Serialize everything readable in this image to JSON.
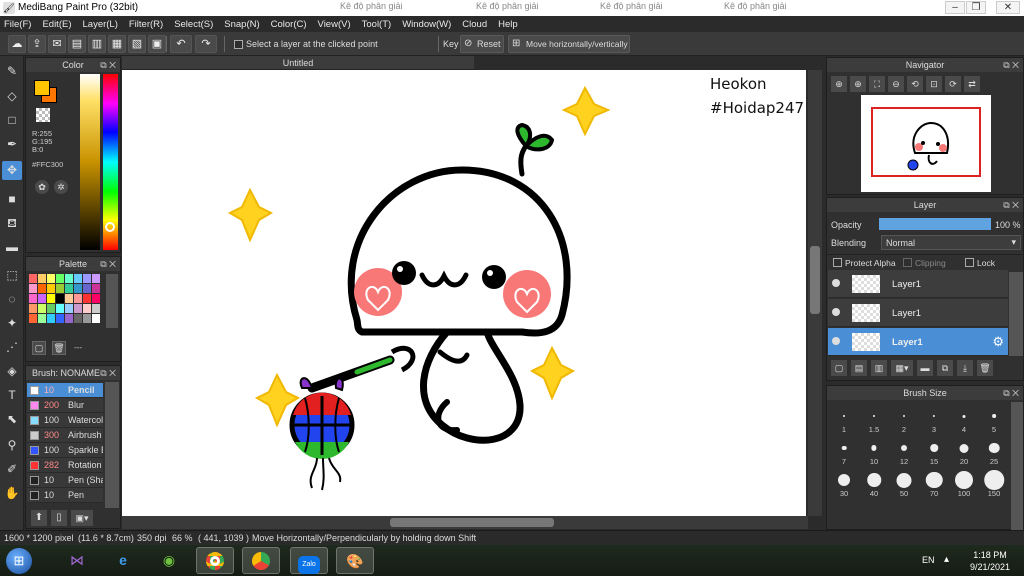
{
  "window": {
    "title": "MediBang Paint Pro (32bit)",
    "background_tabs": [
      "Kê độ phân giải",
      "Kê độ phân giải",
      "Kê độ phân giải",
      "Kê độ phân giải"
    ],
    "controls": [
      "–",
      "❐",
      "✕"
    ]
  },
  "menu": [
    "File(F)",
    "Edit(E)",
    "Layer(L)",
    "Filter(R)",
    "Select(S)",
    "Snap(N)",
    "Color(C)",
    "View(V)",
    "Tool(T)",
    "Window(W)",
    "Cloud",
    "Help"
  ],
  "toolbar": {
    "select_layer_label": "Select a layer at the clicked point",
    "key_label": "Key",
    "reset_label": "Reset",
    "move_label": "Move horizontally/vertically"
  },
  "color_panel": {
    "title": "Color",
    "primary": "#FFC300",
    "r": "R:255",
    "g": "G:195",
    "b": "B:0",
    "hex": "#FFC300"
  },
  "palette_panel": {
    "title": "Palette",
    "colors": [
      "#ff6666",
      "#ffcc66",
      "#ffff66",
      "#66ff66",
      "#66ffcc",
      "#66ccff",
      "#9999ff",
      "#cc99ff",
      "#ff99cc",
      "#ff6600",
      "#ffcc00",
      "#99cc33",
      "#33cc99",
      "#3399cc",
      "#6666cc",
      "#cc3399",
      "#ff66cc",
      "#cc66ff",
      "#ffff00",
      "#000000",
      "#ffcc99",
      "#ff9999",
      "#ff3333",
      "#ff0066",
      "#ff9966",
      "#ccff66",
      "#66cc66",
      "#66ffff",
      "#99ccff",
      "#cc99cc",
      "#ffcccc",
      "#cccccc",
      "#ff6633",
      "#99ff99",
      "#33ccff",
      "#3366ff",
      "#9966cc",
      "#666666",
      "#999999",
      "#ffffff"
    ],
    "dash": "---"
  },
  "brush_panel": {
    "title": "Brush: NONAME",
    "items": [
      {
        "size": "10",
        "name": "Pencil",
        "color": "#ffffff",
        "active": true
      },
      {
        "size": "200",
        "name": "Blur",
        "color": "#ff88ee",
        "active": false
      },
      {
        "size": "100",
        "name": "Watercolor",
        "color": "#88ddff",
        "active": false
      },
      {
        "size": "300",
        "name": "Airbrush",
        "color": "#cccccc",
        "active": false
      },
      {
        "size": "100",
        "name": "Sparkle Brush",
        "color": "#3355ff",
        "active": false
      },
      {
        "size": "282",
        "name": "Rotation",
        "color": "#ff3333",
        "active": false
      },
      {
        "size": "10",
        "name": "Pen (Sharp)",
        "color": "#222222",
        "active": false
      },
      {
        "size": "10",
        "name": "Pen",
        "color": "#222222",
        "active": false
      }
    ]
  },
  "canvas": {
    "tab": "Untitled",
    "watermark_line1": "Heokon",
    "watermark_line2": "#Hoidap247"
  },
  "navigator": {
    "title": "Navigator"
  },
  "layer_panel": {
    "title": "Layer",
    "opacity_label": "Opacity",
    "opacity_value": "100 %",
    "opacity_fraction": 1.0,
    "blending_label": "Blending",
    "blending_value": "Normal",
    "protect_alpha": "Protect Alpha",
    "clipping": "Clipping",
    "lock": "Lock",
    "layers": [
      "Layer1",
      "Layer1",
      "Layer1"
    ]
  },
  "brush_size_panel": {
    "title": "Brush Size",
    "sizes": [
      "1",
      "1.5",
      "2",
      "3",
      "4",
      "5",
      "7",
      "10",
      "12",
      "15",
      "20",
      "25",
      "30",
      "40",
      "50",
      "70",
      "100",
      "150"
    ]
  },
  "status": {
    "dimensions": "1600 * 1200 pixel",
    "physical": "(11.6 * 8.7cm)",
    "dpi": "350 dpi",
    "zoom": "66 %",
    "coords": "( 441, 1039 )",
    "hint": "Move Horizontally/Perpendicularly by holding down Shift"
  },
  "taskbar": {
    "language": "EN",
    "time": "1:18 PM",
    "date": "9/21/2021"
  }
}
